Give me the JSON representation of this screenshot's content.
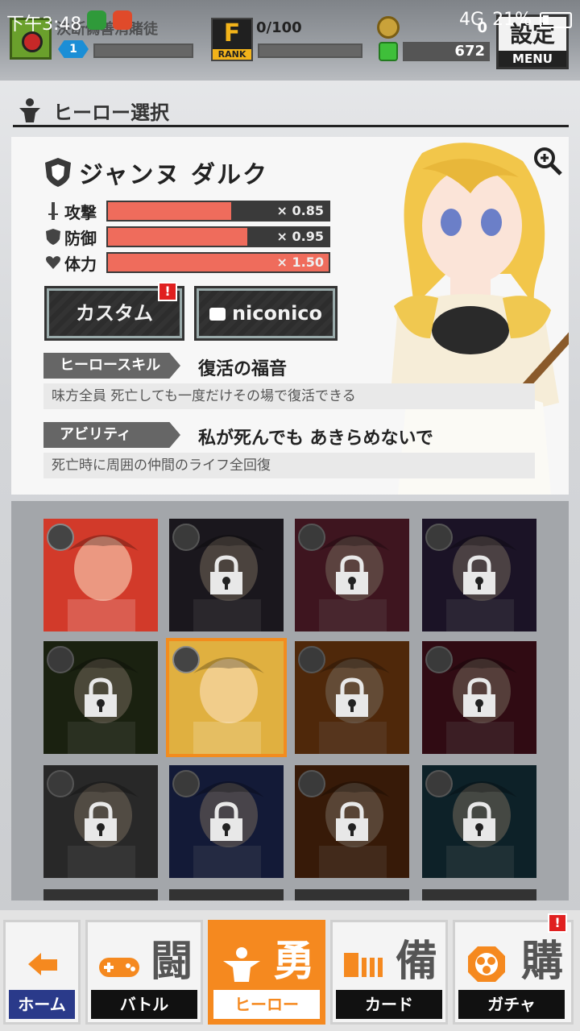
{
  "status_bar": {
    "time": "下午3:48",
    "network": "4G",
    "battery": "21%"
  },
  "header": {
    "player_name": "決断偽善消賭徒",
    "rank_letter": "F",
    "rank_label": "RANK",
    "rank_progress": "0/100",
    "coins": "0",
    "gems": "672",
    "menu_kanji": "設定",
    "menu_label": "MENU"
  },
  "section": {
    "title": "ヒーロー選択"
  },
  "hero": {
    "name": "ジャンヌ ダルク",
    "stats": [
      {
        "label": "攻撃",
        "value": "× 0.85",
        "fill_fraction": 0.56
      },
      {
        "label": "防御",
        "value": "× 0.95",
        "fill_fraction": 0.63
      },
      {
        "label": "体力",
        "value": "× 1.50",
        "fill_fraction": 1.0
      }
    ],
    "custom_button": "カスタム",
    "niconico_button": "niconico",
    "alert_mark": "!",
    "skill_tag": "ヒーロースキル",
    "skill_name": "復活の福音",
    "skill_desc": "味方全員 死亡しても一度だけその場で復活できる",
    "ability_tag": "アビリティ",
    "ability_name": "私が死んでも あきらめないで",
    "ability_desc": "死亡時に周囲の仲間のライフ全回復"
  },
  "hero_grid": {
    "tiles": [
      {
        "type": "speed",
        "locked": false,
        "selected": false,
        "color": "#d23a2a"
      },
      {
        "type": "tank",
        "locked": true,
        "selected": false,
        "color": "#3a3340"
      },
      {
        "type": "power",
        "locked": true,
        "selected": false,
        "color": "#8a2f45"
      },
      {
        "type": "magic",
        "locked": true,
        "selected": false,
        "color": "#3c2c55"
      },
      {
        "type": "magic",
        "locked": true,
        "selected": false,
        "color": "#3a4a24"
      },
      {
        "type": "tank",
        "locked": false,
        "selected": true,
        "color": "#e0b040"
      },
      {
        "type": "magic",
        "locked": true,
        "selected": false,
        "color": "#b05a18"
      },
      {
        "type": "power",
        "locked": true,
        "selected": false,
        "color": "#6a1a2a"
      },
      {
        "type": "speed",
        "locked": true,
        "selected": false,
        "color": "#5a5a5a"
      },
      {
        "type": "power",
        "locked": true,
        "selected": false,
        "color": "#2a3a7a"
      },
      {
        "type": "magic",
        "locked": true,
        "selected": false,
        "color": "#7a3a12"
      },
      {
        "type": "power",
        "locked": true,
        "selected": false,
        "color": "#1e4a5a"
      }
    ]
  },
  "bottom_nav": [
    {
      "kanji": "",
      "label": "ホーム"
    },
    {
      "kanji": "闘",
      "label": "バトル"
    },
    {
      "kanji": "勇",
      "label": "ヒーロー"
    },
    {
      "kanji": "備",
      "label": "カード"
    },
    {
      "kanji": "購",
      "label": "ガチャ"
    }
  ],
  "colors": {
    "accent": "#f5891f",
    "stat_fill": "#ef6c5c",
    "alert": "#e02020"
  }
}
